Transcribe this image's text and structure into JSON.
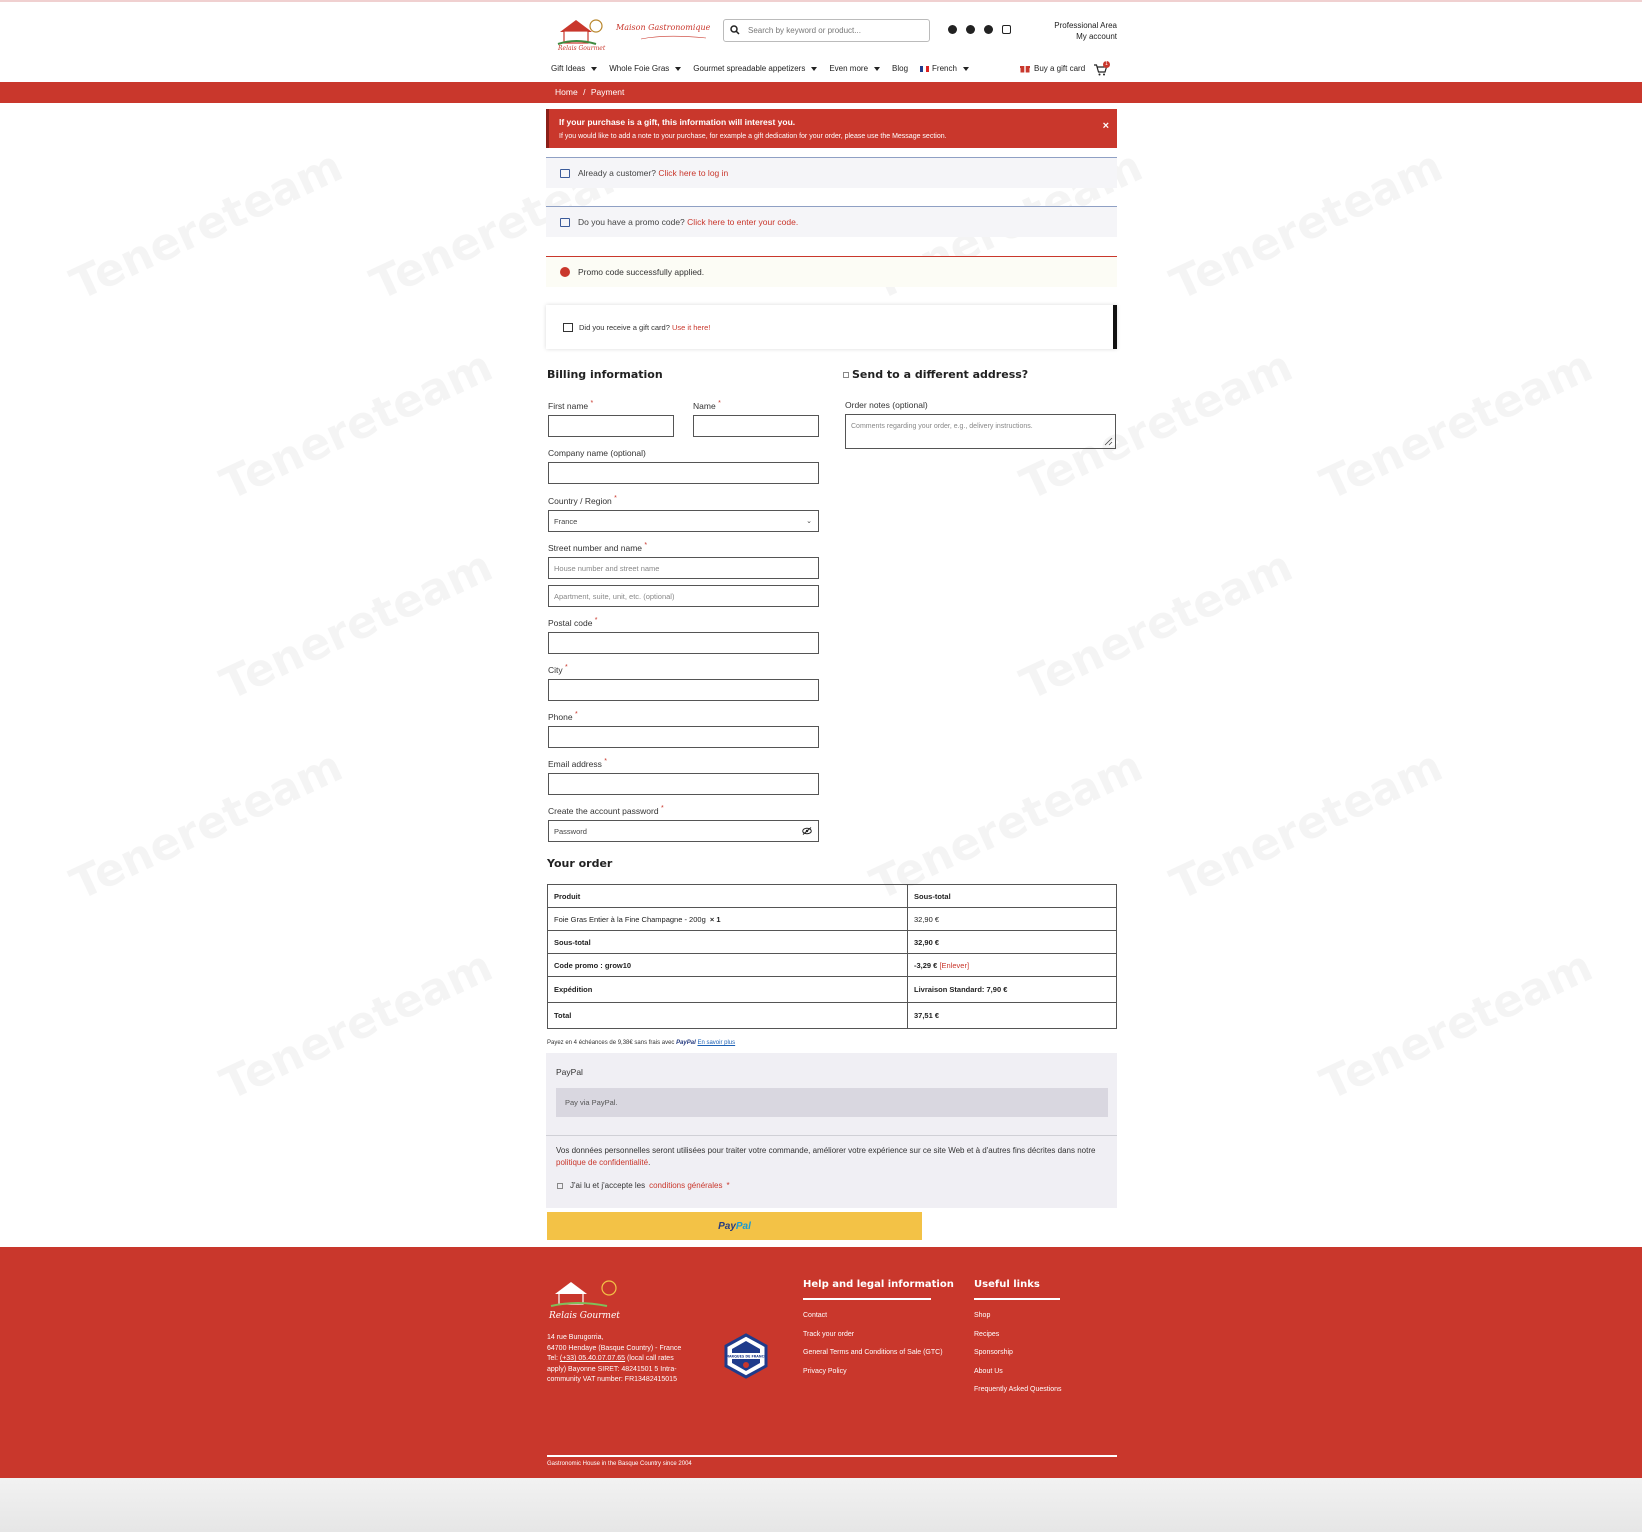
{
  "header": {
    "logo_text": "Maison Gastronomique",
    "search_placeholder": "Search by keyword or product...",
    "social": [
      "facebook-icon",
      "twitter-icon",
      "pinterest-icon",
      "instagram-icon"
    ],
    "pro_area": "Professional Area",
    "my_account": "My account"
  },
  "nav": {
    "items": [
      "Gift Ideas",
      "Whole Foie Gras",
      "Gourmet spreadable appetizers",
      "Even more",
      "Blog"
    ],
    "language": "French",
    "gift_card": "Buy a gift card",
    "cart_count": "1"
  },
  "breadcrumb": {
    "home": "Home",
    "sep": "/",
    "current": "Payment"
  },
  "gift_notice": {
    "title": "If your purchase is a gift, this information will interest you.",
    "text": "If you would like to add a note to your purchase, for example a gift dedication for your order, please use the Message section.",
    "close": "×"
  },
  "notices": {
    "customer_text": "Already a customer?",
    "customer_link": "Click here to log in",
    "promo_text": "Do you have a promo code?",
    "promo_link": "Click here to enter your code.",
    "promo_success": "Promo code successfully applied.",
    "giftcard_text": "Did you receive a gift card?",
    "giftcard_link": "Use it here!"
  },
  "billing": {
    "title": "Billing information",
    "first_name": "First name",
    "name": "Name",
    "company": "Company name",
    "optional": "(optional)",
    "country": "Country / Region",
    "country_value": "France",
    "street": "Street number and name",
    "street_placeholder": "House number and street name",
    "street2_placeholder": "Apartment, suite, unit, etc. (optional)",
    "postal": "Postal code",
    "city": "City",
    "phone": "Phone",
    "email": "Email address",
    "password": "Create the account password",
    "password_placeholder": "Password",
    "required": "*"
  },
  "shipping": {
    "different_address": "Send to a different address?",
    "order_notes": "Order notes",
    "order_notes_optional": "(optional)",
    "order_notes_placeholder": "Comments regarding your order, e.g., delivery instructions."
  },
  "order": {
    "title": "Your order",
    "col_product": "Produit",
    "col_subtotal": "Sous-total",
    "product_name": "Foie Gras Entier à la Fine Champagne - 200g",
    "product_qty": "× 1",
    "product_price": "32,90 €",
    "subtotal_label": "Sous-total",
    "subtotal_value": "32,90 €",
    "promo_label": "Code promo : grow10",
    "promo_value": "-3,29 €",
    "promo_remove": "[Enlever]",
    "shipping_label": "Expédition",
    "shipping_value": "Livraison Standard: 7,90 €",
    "total_label": "Total",
    "total_value": "37,51 €"
  },
  "payment": {
    "installments_text": "Payez en 4 échéances de 9,38€ sans frais avec",
    "installments_brand": "PayPal",
    "installments_link": "En savoir plus",
    "method": "PayPal",
    "method_desc": "Pay via PayPal.",
    "privacy_text": "Vos données personnelles seront utilisées pour traiter votre commande, améliorer votre expérience sur ce site Web et à d'autres fins décrites dans notre",
    "privacy_link": "politique de confidentialité",
    "privacy_end": ".",
    "terms_text": "J'ai lu et j'accepte les",
    "terms_link": "conditions générales",
    "terms_req": "*",
    "button_pay": "Pay",
    "button_pal": "Pal"
  },
  "footer": {
    "brand": "Relais Gourmet",
    "address1": "14 rue Burugorria,",
    "address2": "64700 Hendaye (Basque Country) - France",
    "tel_label": "Tel:",
    "tel": "(+33) 05.40.07.07.65",
    "tel_note": "(local call rates apply) Bayonne SIRET: 48241501 5 Intra-community VAT number: FR13482415015",
    "badge_text": "MARQUES DE FRANCE",
    "help_title": "Help and legal information",
    "help_links": [
      "Contact",
      "Track your order",
      "General Terms and Conditions of Sale (GTC)",
      "Privacy Policy"
    ],
    "useful_title": "Useful links",
    "useful_links": [
      "Shop",
      "Recipes",
      "Sponsorship",
      "About Us",
      "Frequently Asked Questions"
    ],
    "copyright": "Gastronomic House in the Basque Country since 2004"
  },
  "colors": {
    "brand_red": "#c9372c",
    "paypal_yellow": "#f3c246"
  }
}
